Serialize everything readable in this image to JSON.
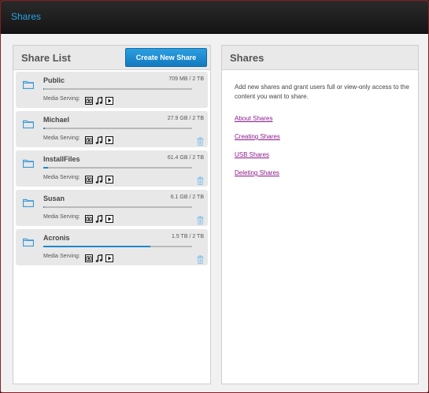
{
  "header": {
    "title": "Shares"
  },
  "share_list": {
    "title": "Share List",
    "create_button": "Create New Share",
    "media_label": "Media Serving:",
    "items": [
      {
        "name": "Public",
        "size": "709 MB / 2 TB",
        "usage_fraction": 0.0,
        "deletable": false
      },
      {
        "name": "Michael",
        "size": "27.9 GB / 2 TB",
        "usage_fraction": 0.01,
        "deletable": true
      },
      {
        "name": "InstallFiles",
        "size": "61.4 GB / 2 TB",
        "usage_fraction": 0.03,
        "deletable": true
      },
      {
        "name": "Susan",
        "size": "6.1 GB / 2 TB",
        "usage_fraction": 0.0,
        "deletable": true
      },
      {
        "name": "Acronis",
        "size": "1.5 TB / 2 TB",
        "usage_fraction": 0.72,
        "deletable": true
      }
    ],
    "media_icons": [
      "photo-icon",
      "music-icon",
      "video-icon"
    ]
  },
  "info_panel": {
    "title": "Shares",
    "description": "Add new shares and grant users full or view-only access to the content you want to share.",
    "links": [
      "About Shares",
      "Creating Shares",
      "USB Shares",
      "Deleting Shares"
    ]
  },
  "colors": {
    "accent": "#1e88d0",
    "title_blue": "#2ba3e6",
    "link": "#8b1a8b",
    "folder": "#3a9ad9"
  }
}
